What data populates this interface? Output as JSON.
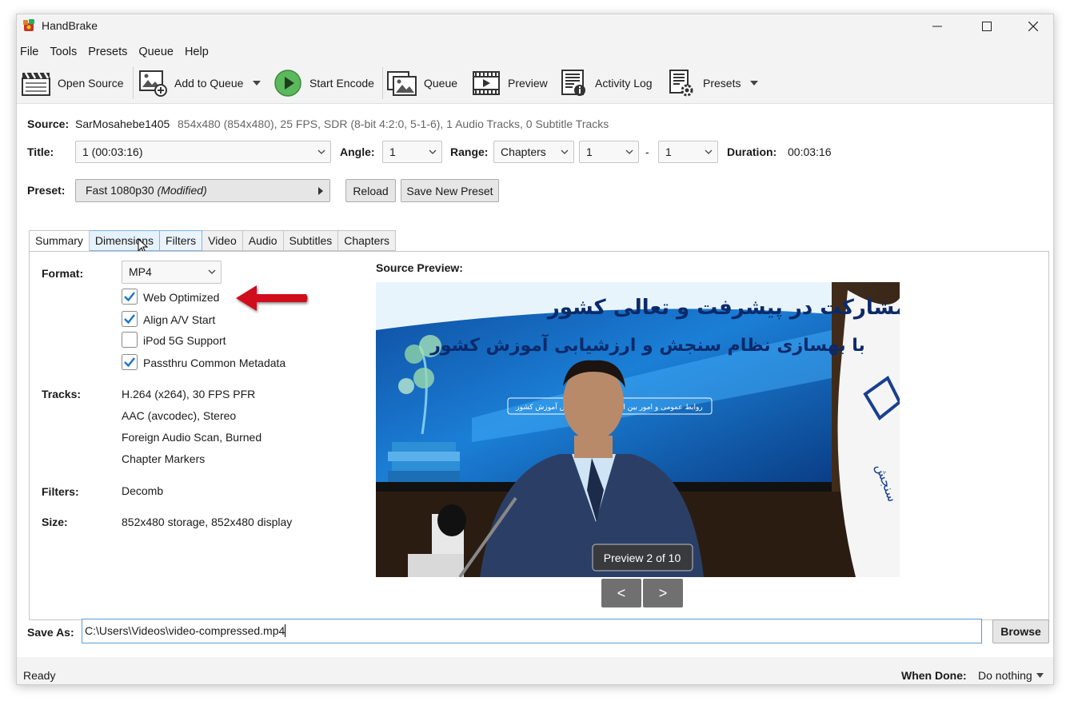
{
  "window": {
    "title": "HandBrake"
  },
  "menu": [
    "File",
    "Tools",
    "Presets",
    "Queue",
    "Help"
  ],
  "toolbar": {
    "open_source": "Open Source",
    "add_to_queue": "Add to Queue",
    "start_encode": "Start Encode",
    "queue": "Queue",
    "preview": "Preview",
    "activity_log": "Activity Log",
    "presets": "Presets"
  },
  "source": {
    "label": "Source:",
    "name": "SarMosahebe1405",
    "info": "854x480 (854x480), 25 FPS, SDR (8-bit 4:2:0, 5-1-6), 1 Audio Tracks, 0 Subtitle Tracks"
  },
  "title_row": {
    "title_label": "Title:",
    "title_value": "1  (00:03:16)",
    "angle_label": "Angle:",
    "angle_value": "1",
    "range_label": "Range:",
    "range_type": "Chapters",
    "range_start": "1",
    "range_sep": "-",
    "range_end": "1",
    "duration_label": "Duration:",
    "duration_value": "00:03:16"
  },
  "preset": {
    "label": "Preset:",
    "name": "Fast 1080p30",
    "modified": "(Modified)",
    "reload": "Reload",
    "save_new": "Save New Preset"
  },
  "tabs": [
    "Summary",
    "Dimensions",
    "Filters",
    "Video",
    "Audio",
    "Subtitles",
    "Chapters"
  ],
  "summary": {
    "format_label": "Format:",
    "format_value": "MP4",
    "options": [
      {
        "label": "Web Optimized",
        "checked": true
      },
      {
        "label": "Align A/V Start",
        "checked": true
      },
      {
        "label": "iPod 5G Support",
        "checked": false
      },
      {
        "label": "Passthru Common Metadata",
        "checked": true
      }
    ],
    "tracks_label": "Tracks:",
    "tracks": [
      "H.264 (x264), 30 FPS PFR",
      "AAC (avcodec), Stereo",
      "Foreign Audio Scan, Burned",
      "Chapter Markers"
    ],
    "filters_label": "Filters:",
    "filters_value": "Decomb",
    "size_label": "Size:",
    "size_value": "852x480 storage, 852x480 display",
    "preview_label": "Source Preview:",
    "preview_banner_line1": "مشارکت در پیشرفت و تعالی کشور",
    "preview_banner_line2": "با بهسازی نظام سنجش و ارزشیابی آموزش کشور",
    "preview_banner_small": "روابط عمومی و امور بین الملل سازمان سنجش آموزش کشور",
    "preview_counter": "Preview 2 of 10",
    "prev_btn": "<",
    "next_btn": ">"
  },
  "save_as": {
    "label": "Save As:",
    "value": "C:\\Users\\Videos\\video-compressed.mp4",
    "browse": "Browse"
  },
  "status": {
    "text": "Ready",
    "when_done_label": "When Done:",
    "when_done_value": "Do nothing"
  },
  "colors": {
    "accent_blue": "#1a73c8",
    "arrow_red": "#d0101a",
    "play_green": "#4caf50"
  }
}
